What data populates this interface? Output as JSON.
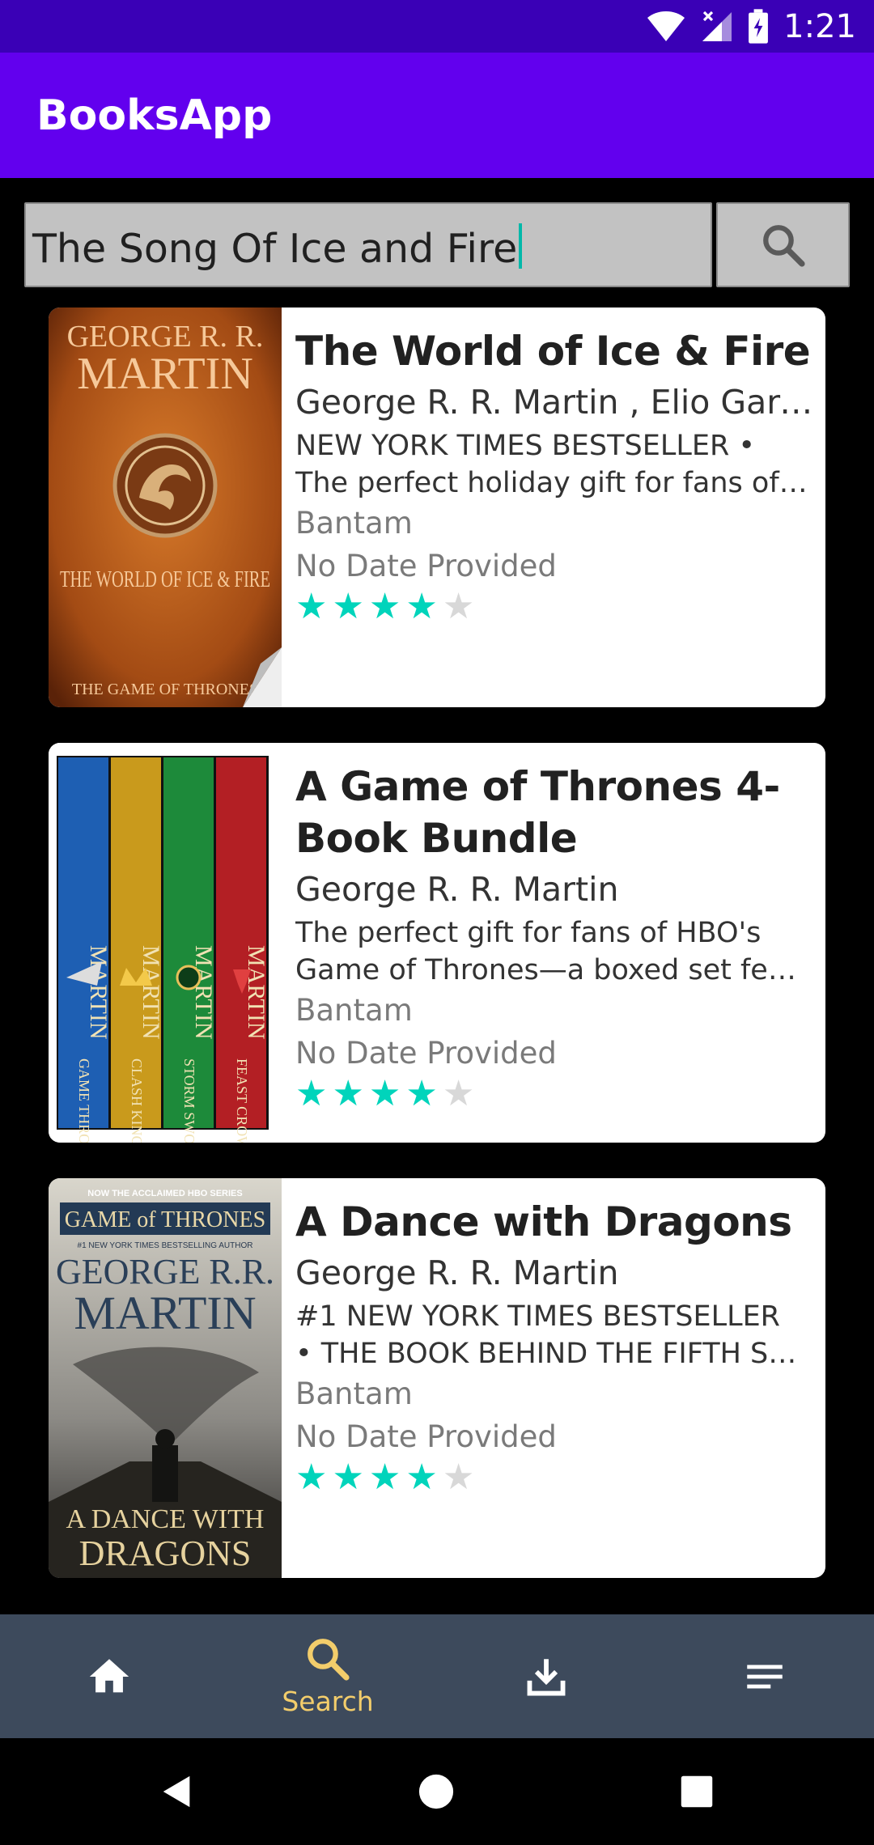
{
  "status_bar": {
    "time": "1:21"
  },
  "app_bar": {
    "title": "BooksApp"
  },
  "search": {
    "query": "The Song Of Ice and Fire"
  },
  "books": [
    {
      "title": "The World of Ice & Fire",
      "authors": "George R. R. Martin , Elio Garcia",
      "description": [
        "NEW YORK TIMES BESTSELLER •",
        "The perfect holiday gift for fans of …"
      ],
      "publisher": "Bantam",
      "date": "No Date Provided",
      "rating": 4,
      "rating_max": 5,
      "cover": {
        "top_text": "GEORGE R. R.",
        "name_text": "MARTIN",
        "title_text": "THE WORLD OF ICE & FIRE",
        "bottom_text": "THE GAME OF THRONES"
      }
    },
    {
      "title": "A Game of Thrones 4-Book Bundle",
      "authors": "George R. R. Martin",
      "description": [
        "The perfect gift for fans of HBO's",
        "Game of Thrones—a boxed set featuring"
      ],
      "publisher": "Bantam",
      "date": "No Date Provided",
      "rating": 4,
      "rating_max": 5,
      "cover": {
        "spine_name": "MARTIN",
        "spines": [
          "GAME THRONES",
          "CLASH KINGS",
          "STORM SWORDS",
          "FEAST CROWS"
        ]
      }
    },
    {
      "title": "A Dance with Dragons",
      "authors": "George R. R. Martin",
      "description": [
        "#1 NEW YORK TIMES BESTSELLER",
        "• THE BOOK BEHIND THE FIFTH SEASON"
      ],
      "publisher": "Bantam",
      "date": "No Date Provided",
      "rating": 4,
      "rating_max": 5,
      "cover": {
        "banner": "NOW THE ACCLAIMED HBO SERIES",
        "series": "GAME of THRONES",
        "tagline": "#1 NEW YORK TIMES BESTSELLING AUTHOR",
        "top_text": "GEORGE R.R.",
        "name_text": "MARTIN",
        "title_line1": "A DANCE WITH",
        "title_line2": "DRAGONS"
      }
    }
  ],
  "bottom_nav": {
    "search_label": "Search"
  },
  "colors": {
    "app_bar": "#6200ee",
    "status_bar": "#3a00b6",
    "star_on": "#00d4bb",
    "star_off": "#d8d8d8",
    "nav_bg": "#3d4a5c",
    "nav_active": "#f3cd6b"
  }
}
